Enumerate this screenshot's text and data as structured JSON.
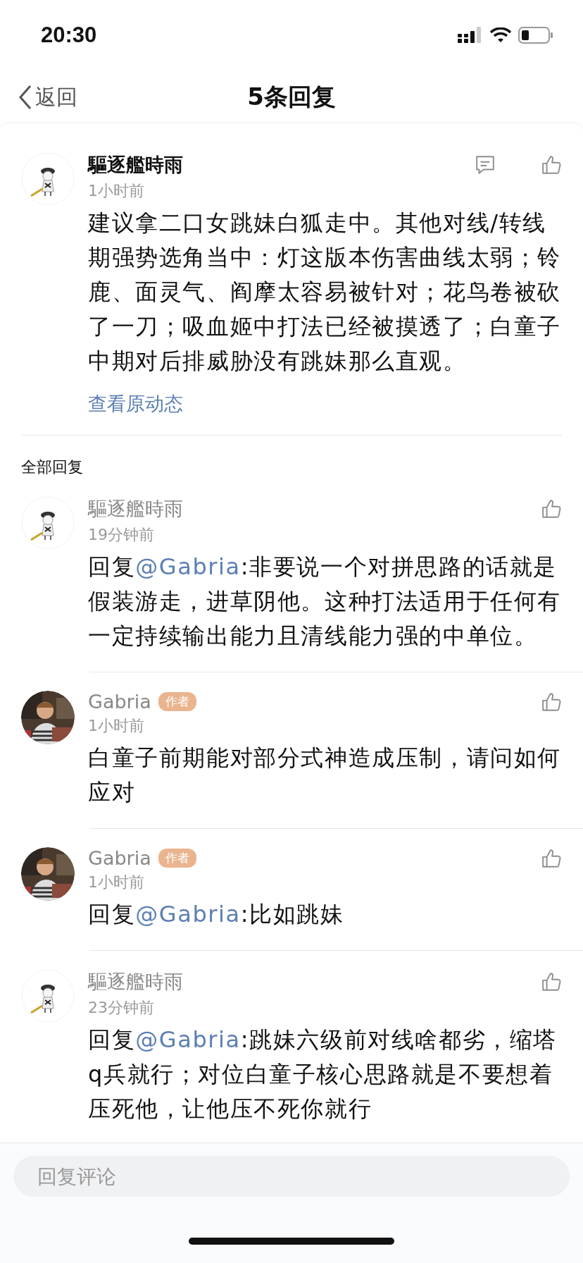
{
  "status_bar": {
    "time": "20:30"
  },
  "nav": {
    "back": "返回",
    "title": "5条回复"
  },
  "main_comment": {
    "author": "驅逐艦時雨",
    "time": "1小时前",
    "text": "建议拿二口女跳妹白狐走中。其他对线/转线期强势选角当中：灯这版本伤害曲线太弱；铃鹿、面灵气、阎摩太容易被针对；花鸟卷被砍了一刀；吸血姬中打法已经被摸透了；白童子中期对后排威胁没有跳妹那么直观。",
    "link": "查看原动态",
    "avatar": {
      "kind": "drawing"
    }
  },
  "section_title": "全部回复",
  "replies": [
    {
      "author": "驅逐艦時雨",
      "time": "19分钟前",
      "avatar": {
        "kind": "drawing"
      },
      "prefix": "回复",
      "mention": "@Gabria",
      "text": ":非要说一个对拼思路的话就是假装游走，进草阴他。这种打法适用于任何有一定持续输出能力且清线能力强的中单位。"
    },
    {
      "author": "Gabria",
      "badge": "作者",
      "time": "1小时前",
      "text": "白童子前期能对部分式神造成压制，请问如何应对"
    },
    {
      "author": "Gabria",
      "badge": "作者",
      "time": "1小时前",
      "prefix": "回复",
      "mention": "@Gabria",
      "text": ":比如跳妹"
    },
    {
      "author": "驅逐艦時雨",
      "time": "23分钟前",
      "avatar": {
        "kind": "drawing"
      },
      "prefix": "回复",
      "mention": "@Gabria",
      "text": ":跳妹六级前对线啥都劣，缩塔q兵就行；对位白童子核心思路就是不要想着压死他，让他压不死你就行"
    }
  ],
  "reply_input": {
    "placeholder": "回复评论"
  }
}
